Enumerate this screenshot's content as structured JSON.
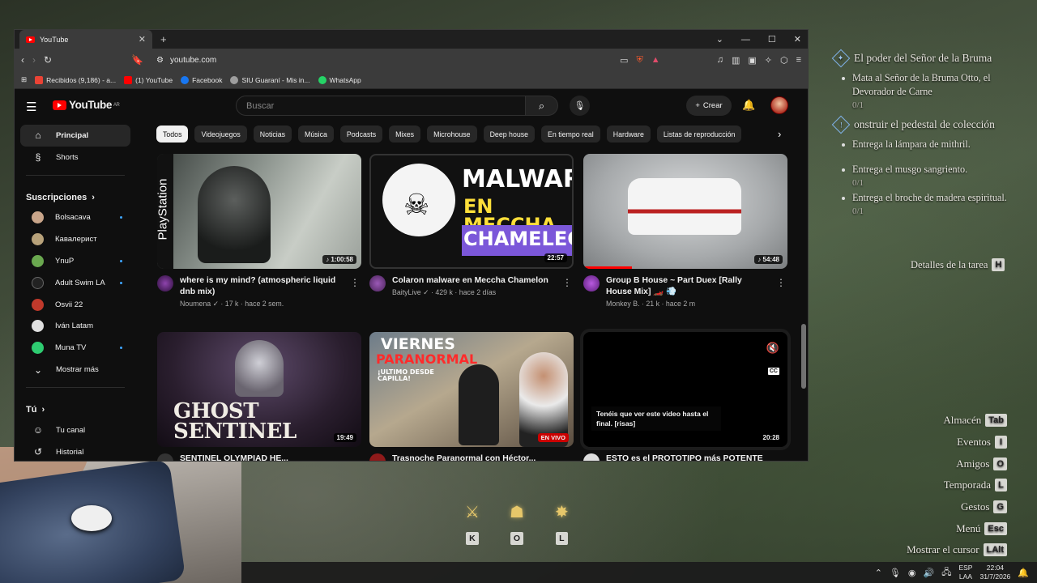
{
  "browser": {
    "tab_title": "YouTube",
    "url": "youtube.com",
    "bookmarks": [
      {
        "label": "Recibidos (9,186) - a...",
        "color": "#ea4335"
      },
      {
        "label": "(1) YouTube",
        "color": "#ff0000"
      },
      {
        "label": "Facebook",
        "color": "#1877f2"
      },
      {
        "label": "SIU Guaraní - Mis in...",
        "color": "#9e9e9e"
      },
      {
        "label": "WhatsApp",
        "color": "#25d366"
      }
    ]
  },
  "youtube": {
    "logo": "YouTube",
    "region": "AR",
    "search_placeholder": "Buscar",
    "create_label": "Crear",
    "sidebar": {
      "main": [
        {
          "label": "Principal",
          "icon": "home-icon"
        },
        {
          "label": "Shorts",
          "icon": "shorts-icon"
        }
      ],
      "subs_heading": "Suscripciones",
      "subs": [
        {
          "label": "Bolsacava",
          "color": "#c9a58a",
          "new": true
        },
        {
          "label": "Кавалерист",
          "color": "#b8a27a",
          "new": false
        },
        {
          "label": "YnuP",
          "color": "#6aa84f",
          "new": true
        },
        {
          "label": "Adult Swim LA",
          "color": "#222222",
          "new": true
        },
        {
          "label": "Osvii 22",
          "color": "#c0392b",
          "new": false
        },
        {
          "label": "Iván Latam",
          "color": "#e0e0e0",
          "new": false
        },
        {
          "label": "Muna TV",
          "color": "#2ecc71",
          "new": true
        }
      ],
      "show_more": "Mostrar más",
      "you_heading": "Tú",
      "you": [
        {
          "label": "Tu canal",
          "icon": "channel-icon"
        },
        {
          "label": "Historial",
          "icon": "history-icon"
        }
      ]
    },
    "chips": [
      "Todos",
      "Videojuegos",
      "Noticias",
      "Música",
      "Podcasts",
      "Mixes",
      "Microhouse",
      "Deep house",
      "En tiempo real",
      "Hardware",
      "Listas de reproducción"
    ],
    "videos": [
      {
        "title": "where is my mind? (atmospheric liquid dnb mix)",
        "channel": "Noumena",
        "views": "17 k",
        "age": "hace 2 sem.",
        "duration": "1:00:58"
      },
      {
        "title": "Colaron malware en Meccha Chamelon",
        "channel": "BaityLive",
        "views": "429 k",
        "age": "hace 2 días",
        "duration": "22:57",
        "thumb_text": [
          "MALWARE",
          "EN",
          "MECCHA",
          "CHAMELEON"
        ]
      },
      {
        "title": "Group B House ~ Part Duex [Rally House Mix] 🏎️ 💨",
        "channel": "Monkey B.",
        "views": "21 k",
        "age": "hace 2 m",
        "duration": "54:48"
      },
      {
        "title": "SENTINEL OLYMPIAD HE...",
        "duration": "19:49",
        "thumb_text": "GHOST SENTINEL"
      },
      {
        "title": "Trasnoche Paranormal con Héctor...",
        "badge": "EN VIVO",
        "thumb_text": [
          "VIERNES",
          "PARANORMAL",
          "¡ULTIMO DESDE CAPILLA!"
        ]
      },
      {
        "title": "ESTO es el PROTOTIPO más POTENTE del...",
        "duration": "20:28",
        "caption": "Tenéis que ver este video hasta el final. [risas]",
        "cc": "CC"
      }
    ],
    "playstation_label": "PlayStation"
  },
  "game": {
    "quests": [
      {
        "title": "El poder del Señor de la Bruma",
        "items": [
          "Mata al Señor de la Bruma Otto, el Devorador de Carne"
        ],
        "progress": [
          "0/1"
        ]
      },
      {
        "title": "onstruir el pedestal de colección",
        "items": [
          "Entrega la lámpara de mithril.",
          "Entrega el musgo sangriento.",
          "Entrega el broche de madera espiritual."
        ],
        "progress": [
          "",
          "0/1",
          "0/1"
        ]
      }
    ],
    "task_details": "Detalles de la tarea",
    "task_details_key": "H",
    "hotkeys": [
      {
        "label": "Almacén",
        "key": "Tab"
      },
      {
        "label": "Eventos",
        "key": "I"
      },
      {
        "label": "Amigos",
        "key": "O"
      },
      {
        "label": "Temporada",
        "key": "L"
      },
      {
        "label": "Gestos",
        "key": "G"
      },
      {
        "label": "Menú",
        "key": "Esc"
      },
      {
        "label": "Mostrar el cursor",
        "key": "LAlt"
      }
    ],
    "abilities": [
      "K",
      "O",
      "L"
    ]
  },
  "taskbar": {
    "lang": "ESP",
    "layout": "LAA",
    "time": "22:04",
    "date": "31/7/2026"
  }
}
